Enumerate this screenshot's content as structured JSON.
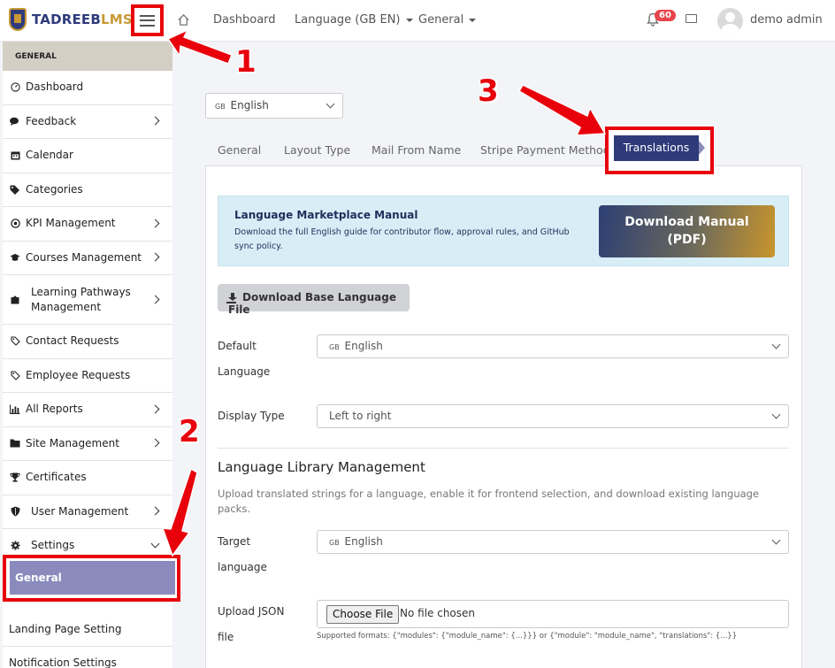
{
  "header": {
    "logo_text_main": "TADREEB",
    "logo_text_accent": "LMS",
    "nav": {
      "dashboard": "Dashboard",
      "language": "Language (GB EN)",
      "general": "General"
    },
    "notification_count": "60",
    "user_name": "demo admin"
  },
  "sidebar": {
    "section_title": "GENERAL",
    "items": [
      {
        "label": "Dashboard",
        "icon": "gauge-icon"
      },
      {
        "label": "Feedback",
        "icon": "comments-icon"
      },
      {
        "label": "Calendar",
        "icon": "calendar-icon"
      },
      {
        "label": "Categories",
        "icon": "tags-icon"
      },
      {
        "label": "KPI Management",
        "icon": "target-icon"
      },
      {
        "label": "Courses Management",
        "icon": "graduation-cap-icon"
      },
      {
        "label": "Learning Pathways Management",
        "icon": "puzzle-icon"
      },
      {
        "label": "Contact Requests",
        "icon": "tag-icon"
      },
      {
        "label": "Employee Requests",
        "icon": "tag-icon"
      },
      {
        "label": "All Reports",
        "icon": "bar-chart-icon"
      },
      {
        "label": "Site Management",
        "icon": "folder-icon"
      },
      {
        "label": "Certificates",
        "icon": "trophy-icon"
      },
      {
        "label": "User Management",
        "icon": "shield-icon"
      },
      {
        "label": "Settings",
        "icon": "gear-icon"
      }
    ],
    "active_sub": "General",
    "sub_items": [
      "Landing Page Setting",
      "Notification Settings"
    ]
  },
  "language_selector": {
    "flag": "GB",
    "value": "English"
  },
  "tabs": [
    "General",
    "Layout Type",
    "Mail From Name",
    "Stripe Payment Method",
    "Translations"
  ],
  "info_box": {
    "title": "Language Marketplace Manual",
    "description": "Download the full English guide for contributor flow, approval rules, and GitHub sync policy.",
    "button_line1": "Download Manual",
    "button_line2": "(PDF)"
  },
  "base_button": "Download Base Language File",
  "form": {
    "default_language_label_1": "Default",
    "default_language_label_2": "Language",
    "default_language_value": "English",
    "display_type_label": "Display Type",
    "display_type_value": "Left to right",
    "section_title": "Language Library Management",
    "section_desc": "Upload translated strings for a language, enable it for frontend selection, and download existing language packs.",
    "target_label_1": "Target",
    "target_label_2": "language",
    "target_value": "English",
    "upload_label_1": "Upload JSON",
    "upload_label_2": "file",
    "choose_file": "Choose File",
    "no_file": "No file chosen",
    "hint": "Supported formats: {\"modules\": {\"module_name\": {...}}} or {\"module\": \"module_name\", \"translations\": {...}}"
  },
  "annotations": {
    "step1": "1",
    "step2": "2",
    "step3": "3",
    "color": "#e8000b"
  },
  "colors": {
    "brand_navy": "#2e3a7a",
    "brand_gold": "#c79a35",
    "active_item": "#8a8bbc"
  }
}
